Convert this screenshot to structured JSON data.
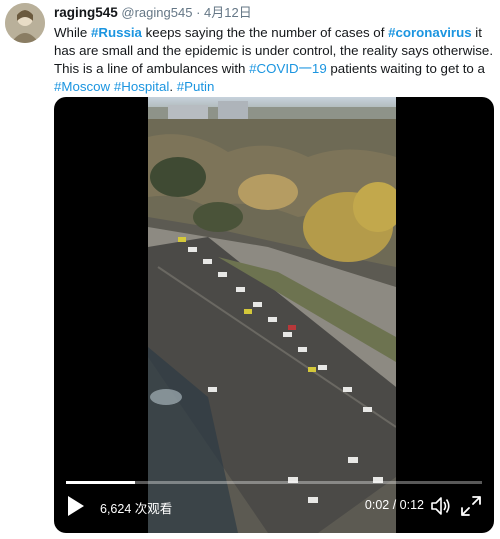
{
  "tweet": {
    "display_name": "raging545",
    "handle": "@raging545",
    "separator": "·",
    "date": "4月12日",
    "text_parts": {
      "p1": "While ",
      "t1": "#Russia",
      "p2": " keeps saying the the number of cases of ",
      "t2": "#coronavirus",
      "p3": " it has are small and the epidemic is under control, the reality says otherwise. This is a line of ambulances with ",
      "t3": "#COVID一19",
      "p4": " patients waiting to get to a ",
      "t4": "#Moscow",
      "p5": " ",
      "t5": "#Hospital",
      "p6": ". ",
      "t6": "#Putin"
    }
  },
  "video": {
    "views": "6,624 次观看",
    "time": "0:02 / 0:12",
    "progress": 0.167,
    "icons": [
      "play-icon",
      "volume-icon",
      "fullscreen-icon"
    ]
  },
  "colors": {
    "hashtag": "#1b95e0",
    "text": "#14171a",
    "muted": "#657786",
    "video_bg": "#000000"
  }
}
